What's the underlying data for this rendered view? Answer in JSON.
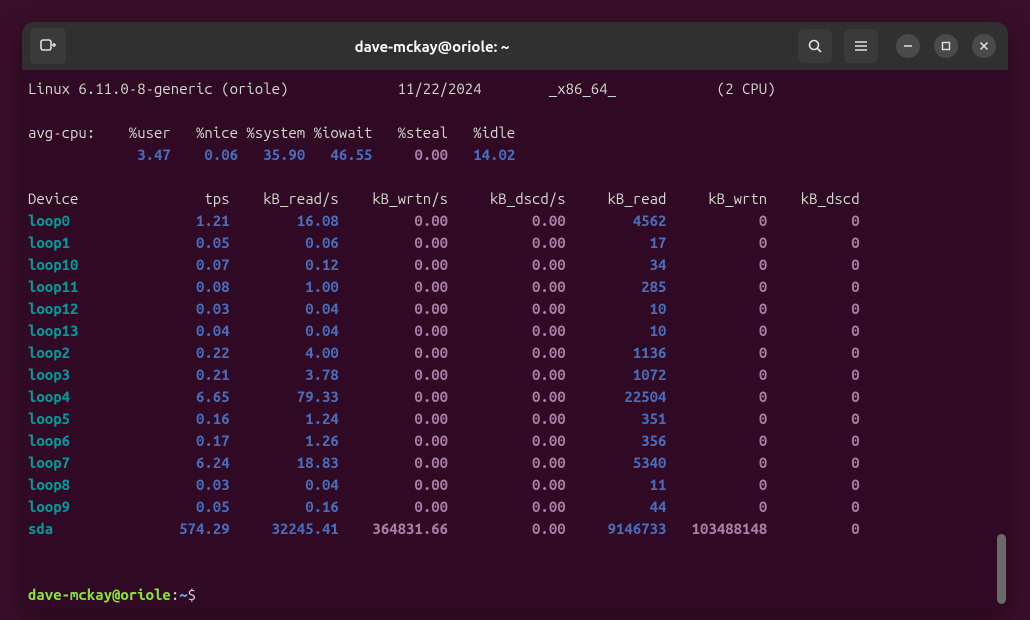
{
  "window": {
    "title": "dave-mckay@oriole: ~"
  },
  "system_line": {
    "os": "Linux 6.11.0-8-generic (oriole)",
    "date": "11/22/2024",
    "arch": "_x86_64_",
    "cpu": "(2 CPU)"
  },
  "cpu_header": {
    "label": "avg-cpu:",
    "cols": [
      "%user",
      "%nice",
      "%system",
      "%iowait",
      "%steal",
      "%idle"
    ]
  },
  "cpu_values": {
    "user": "3.47",
    "nice": "0.06",
    "system": "35.90",
    "iowait": "46.55",
    "steal": "0.00",
    "idle": "14.02"
  },
  "device_header": [
    "Device",
    "tps",
    "kB_read/s",
    "kB_wrtn/s",
    "kB_dscd/s",
    "kB_read",
    "kB_wrtn",
    "kB_dscd"
  ],
  "devices": [
    {
      "name": "loop0",
      "tps": "1.21",
      "rd_s": "16.08",
      "wr_s": "0.00",
      "ds_s": "0.00",
      "rd": "4562",
      "wr": "0",
      "ds": "0"
    },
    {
      "name": "loop1",
      "tps": "0.05",
      "rd_s": "0.06",
      "wr_s": "0.00",
      "ds_s": "0.00",
      "rd": "17",
      "wr": "0",
      "ds": "0"
    },
    {
      "name": "loop10",
      "tps": "0.07",
      "rd_s": "0.12",
      "wr_s": "0.00",
      "ds_s": "0.00",
      "rd": "34",
      "wr": "0",
      "ds": "0"
    },
    {
      "name": "loop11",
      "tps": "0.08",
      "rd_s": "1.00",
      "wr_s": "0.00",
      "ds_s": "0.00",
      "rd": "285",
      "wr": "0",
      "ds": "0"
    },
    {
      "name": "loop12",
      "tps": "0.03",
      "rd_s": "0.04",
      "wr_s": "0.00",
      "ds_s": "0.00",
      "rd": "10",
      "wr": "0",
      "ds": "0"
    },
    {
      "name": "loop13",
      "tps": "0.04",
      "rd_s": "0.04",
      "wr_s": "0.00",
      "ds_s": "0.00",
      "rd": "10",
      "wr": "0",
      "ds": "0"
    },
    {
      "name": "loop2",
      "tps": "0.22",
      "rd_s": "4.00",
      "wr_s": "0.00",
      "ds_s": "0.00",
      "rd": "1136",
      "wr": "0",
      "ds": "0"
    },
    {
      "name": "loop3",
      "tps": "0.21",
      "rd_s": "3.78",
      "wr_s": "0.00",
      "ds_s": "0.00",
      "rd": "1072",
      "wr": "0",
      "ds": "0"
    },
    {
      "name": "loop4",
      "tps": "6.65",
      "rd_s": "79.33",
      "wr_s": "0.00",
      "ds_s": "0.00",
      "rd": "22504",
      "wr": "0",
      "ds": "0"
    },
    {
      "name": "loop5",
      "tps": "0.16",
      "rd_s": "1.24",
      "wr_s": "0.00",
      "ds_s": "0.00",
      "rd": "351",
      "wr": "0",
      "ds": "0"
    },
    {
      "name": "loop6",
      "tps": "0.17",
      "rd_s": "1.26",
      "wr_s": "0.00",
      "ds_s": "0.00",
      "rd": "356",
      "wr": "0",
      "ds": "0"
    },
    {
      "name": "loop7",
      "tps": "6.24",
      "rd_s": "18.83",
      "wr_s": "0.00",
      "ds_s": "0.00",
      "rd": "5340",
      "wr": "0",
      "ds": "0"
    },
    {
      "name": "loop8",
      "tps": "0.03",
      "rd_s": "0.04",
      "wr_s": "0.00",
      "ds_s": "0.00",
      "rd": "11",
      "wr": "0",
      "ds": "0"
    },
    {
      "name": "loop9",
      "tps": "0.05",
      "rd_s": "0.16",
      "wr_s": "0.00",
      "ds_s": "0.00",
      "rd": "44",
      "wr": "0",
      "ds": "0"
    },
    {
      "name": "sda",
      "tps": "574.29",
      "rd_s": "32245.41",
      "wr_s": "364831.66",
      "ds_s": "0.00",
      "rd": "9146733",
      "wr": "103488148",
      "ds": "0"
    }
  ],
  "prompt": {
    "user_host": "dave-mckay@oriole",
    "colon": ":",
    "path": "~",
    "dollar": "$"
  }
}
